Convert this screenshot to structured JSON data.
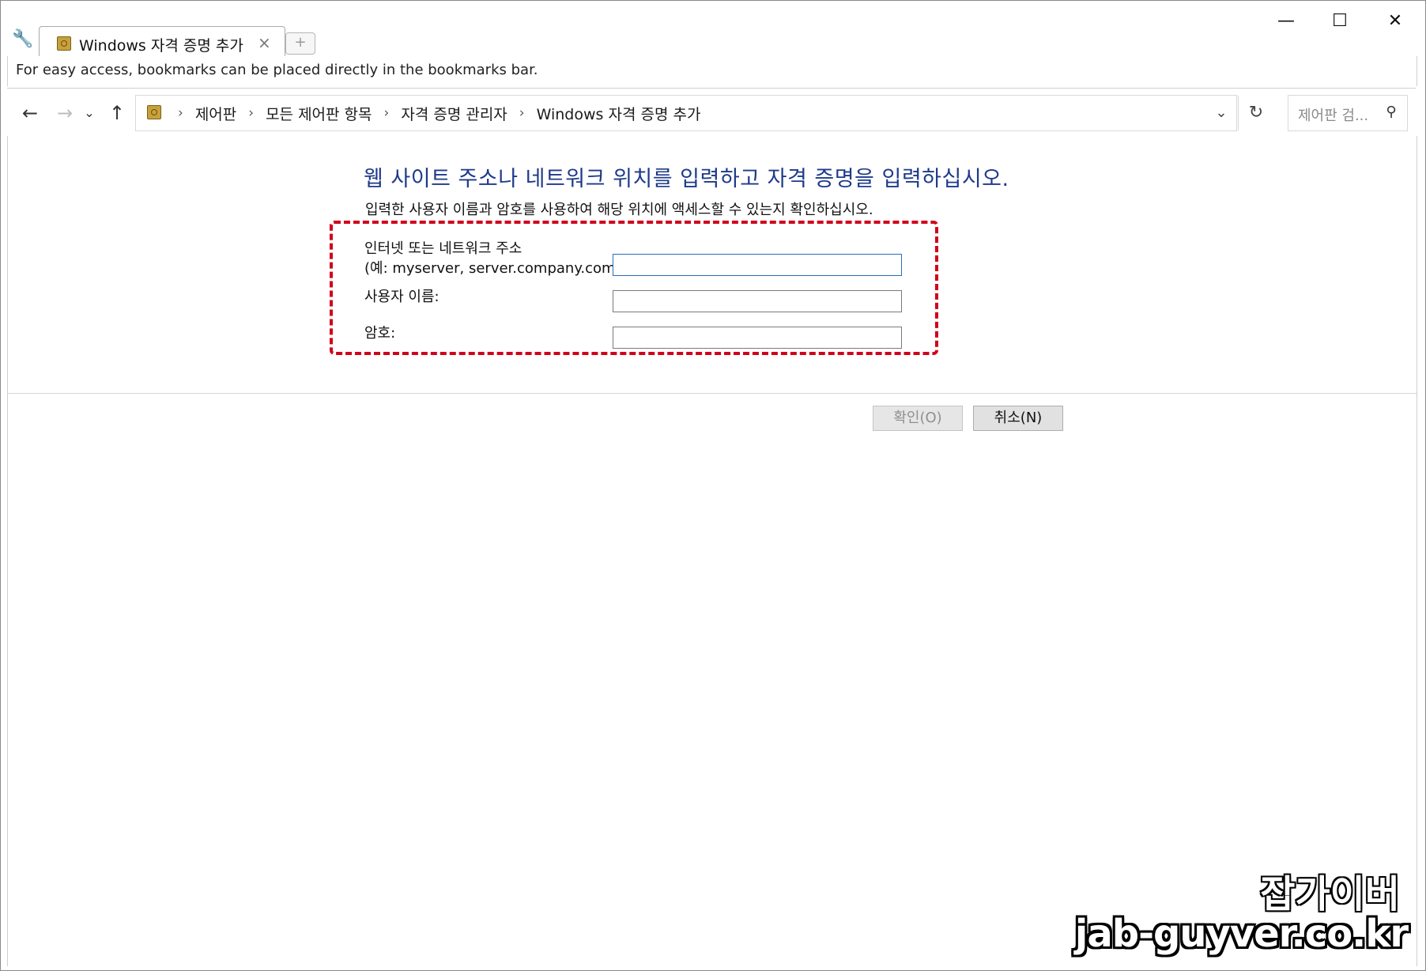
{
  "browser": {
    "tab_title": "Windows 자격 증명 추가",
    "tab_close": "×",
    "new_tab": "+",
    "wrench_icon": "wrench-icon",
    "window_controls": {
      "minimize": "—",
      "maximize": "☐",
      "close": "✕"
    },
    "bookmarks_bar_text": "For easy access, bookmarks can be placed directly in the bookmarks bar."
  },
  "navigation": {
    "back": "←",
    "forward": "→",
    "recent": "⌄",
    "up": "↑",
    "breadcrumbs": [
      "제어판",
      "모든 제어판 항목",
      "자격 증명 관리자",
      "Windows 자격 증명 추가"
    ],
    "separator": "›",
    "dropdown": "⌄",
    "refresh": "↻",
    "search_placeholder": "제어판 검...",
    "search_icon": "⚲"
  },
  "form": {
    "heading": "웹 사이트 주소나 네트워크 위치를 입력하고 자격 증명을 입력하십시오.",
    "description": "입력한 사용자 이름과 암호를 사용하여 해당 위치에 액세스할 수 있는지 확인하십시오.",
    "address_label_line1": "인터넷 또는 네트워크 주소",
    "address_label_line2": "(예: myserver, server.company.com):",
    "address_value": "",
    "username_label": "사용자 이름:",
    "username_value": "",
    "password_label": "암호:",
    "password_value": "",
    "ok_button": "확인(O)",
    "cancel_button": "취소(N)"
  },
  "watermark": {
    "name": "잡가이버",
    "url": "jab-guyver.co.kr"
  },
  "colors": {
    "heading": "#1e3a8a",
    "highlight_border": "#d0021b"
  }
}
